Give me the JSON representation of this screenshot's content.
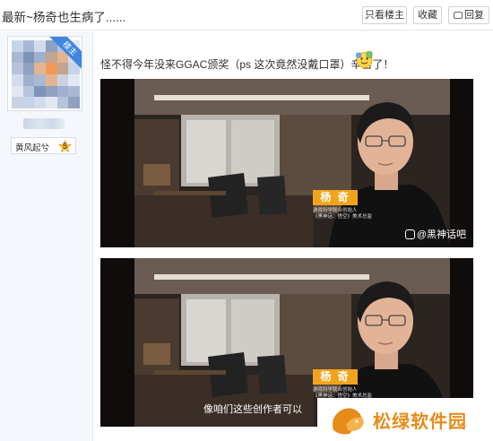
{
  "header": {
    "title": "最新~杨奇也生病了......",
    "only_op_label": "只看楼主",
    "favorite_label": "收藏",
    "reply_label": "回复"
  },
  "user": {
    "op_badge": "楼主",
    "level_title": "黄风起兮",
    "level_number": "5"
  },
  "post": {
    "text": "怪不得今年没来GGAC颁奖（ps 这次竟然没戴口罩）辛苦了！",
    "images": [
      {
        "name_tag": "杨 奇",
        "caption_line1": "游戏科学联合创始人",
        "caption_line2": "《黑神话：悟空》美术总监",
        "watermark": "@黑神话吧",
        "subtitle": ""
      },
      {
        "name_tag": "杨 奇",
        "caption_line1": "游戏科学联合创始人",
        "caption_line2": "《黑神话：悟空》美术总监",
        "watermark": "",
        "subtitle": "像咱们这些创作者可以"
      }
    ]
  },
  "site_watermark": "松绿软件园",
  "colors": {
    "accent_blue": "#3e86e0",
    "name_tag_orange": "#f3a31b",
    "logo_orange": "#e58c1a"
  }
}
